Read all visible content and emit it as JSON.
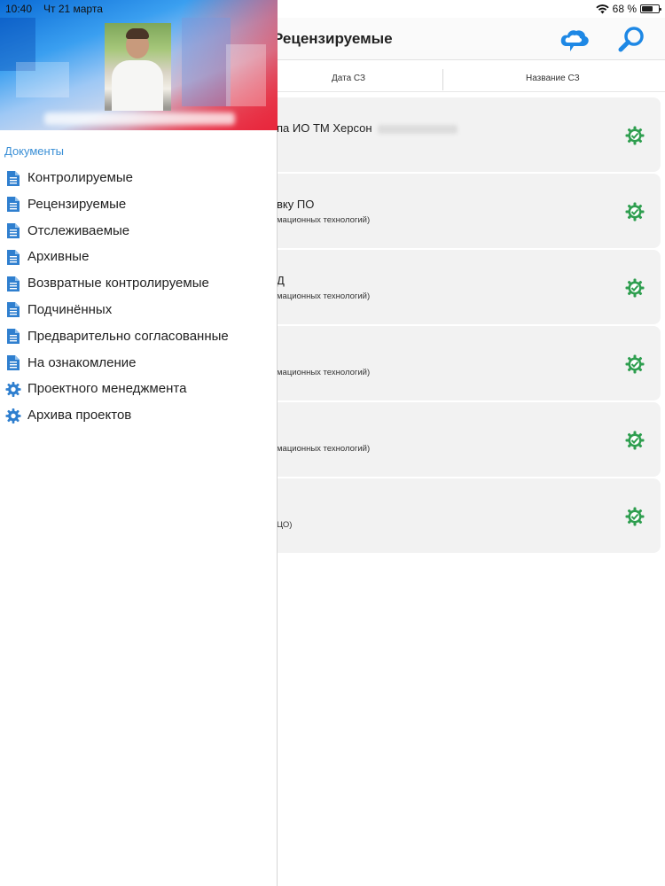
{
  "status_bar": {
    "time": "10:40",
    "date": "Чт 21 марта",
    "battery": "68 %",
    "battery_level": 0.68
  },
  "nav_bar": {
    "title": "Рецензируемые"
  },
  "sort_bar": {
    "columns": [
      "Дата СЗ",
      "Название СЗ"
    ]
  },
  "documents": [
    {
      "title": "па ИО ТМ Херсон",
      "subtitle": "",
      "status_icon": "check-gear-icon"
    },
    {
      "title": "вку ПО",
      "subtitle": "мационных технологий)",
      "status_icon": "check-gear-icon"
    },
    {
      "title": "Д",
      "subtitle": "мационных технологий)",
      "status_icon": "check-gear-icon"
    },
    {
      "title": "",
      "subtitle": "мационных технологий)",
      "status_icon": "check-gear-icon"
    },
    {
      "title": "",
      "subtitle": "мационных технологий)",
      "status_icon": "check-gear-icon"
    },
    {
      "title": "",
      "subtitle": "ЦО)",
      "status_icon": "check-gear-icon"
    }
  ],
  "drawer": {
    "section_title": "Документы",
    "items": [
      {
        "label": "Контролируемые",
        "icon": "document-icon"
      },
      {
        "label": "Рецензируемые",
        "icon": "document-icon"
      },
      {
        "label": "Отслеживаемые",
        "icon": "document-icon"
      },
      {
        "label": "Архивные",
        "icon": "document-icon"
      },
      {
        "label": "Возвратные контролируемые",
        "icon": "document-icon"
      },
      {
        "label": "Подчинённых",
        "icon": "document-icon"
      },
      {
        "label": "Предварительно согласованные",
        "icon": "document-icon"
      },
      {
        "label": "На ознакомление",
        "icon": "document-icon"
      },
      {
        "label": "Проектного менеджмента",
        "icon": "gear-icon"
      },
      {
        "label": "Архива проектов",
        "icon": "gear-icon"
      }
    ]
  },
  "colors": {
    "accent": "#1e88e5",
    "section": "#3a8fd6",
    "check": "#2e9e4f"
  }
}
